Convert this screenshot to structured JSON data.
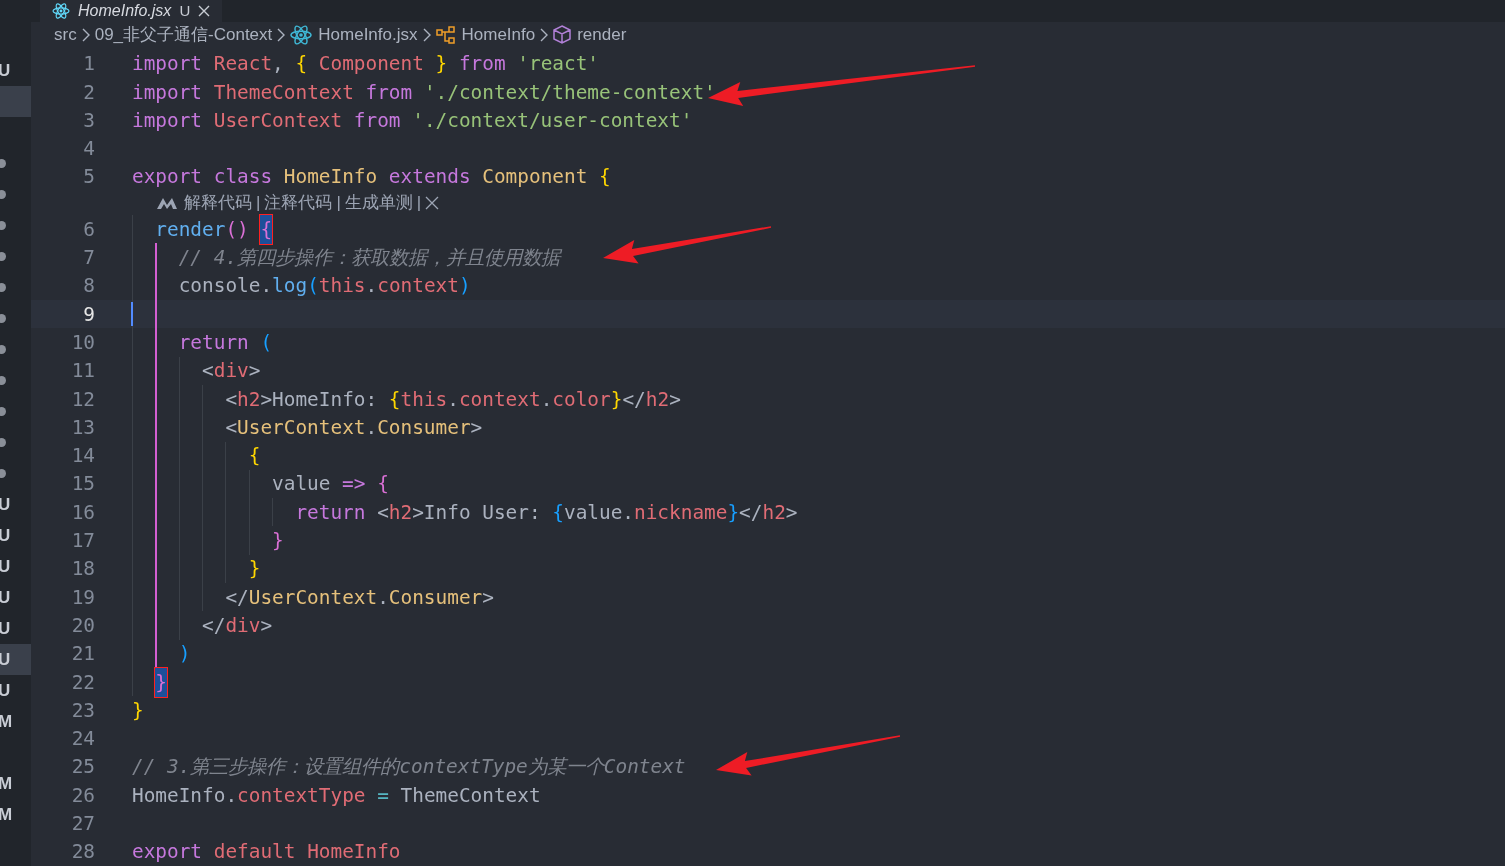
{
  "tab": {
    "title": "HomeInfo.jsx",
    "status": "U"
  },
  "breadcrumbs": [
    {
      "kind": "folder",
      "label": "src"
    },
    {
      "kind": "folder",
      "label": "09_非父子通信-Context"
    },
    {
      "kind": "react",
      "label": "HomeInfo.jsx"
    },
    {
      "kind": "component",
      "label": "HomeInfo"
    },
    {
      "kind": "method",
      "label": "render"
    }
  ],
  "explorer_markers": [
    {
      "kind": "letter",
      "text": "U",
      "selected": false
    },
    {
      "kind": "blank",
      "selected": true
    },
    {
      "kind": "blank",
      "selected": false
    },
    {
      "kind": "dot",
      "selected": false
    },
    {
      "kind": "dot",
      "selected": false
    },
    {
      "kind": "dot",
      "selected": false
    },
    {
      "kind": "dot",
      "selected": false
    },
    {
      "kind": "dot",
      "selected": false
    },
    {
      "kind": "dot",
      "selected": false
    },
    {
      "kind": "dot",
      "selected": false
    },
    {
      "kind": "dot",
      "selected": false
    },
    {
      "kind": "dot",
      "selected": false
    },
    {
      "kind": "dot",
      "selected": false
    },
    {
      "kind": "dot",
      "selected": false
    },
    {
      "kind": "letter",
      "text": "U",
      "selected": false
    },
    {
      "kind": "letter",
      "text": "U",
      "selected": false
    },
    {
      "kind": "letter",
      "text": "U",
      "selected": false
    },
    {
      "kind": "letter",
      "text": "U",
      "selected": false
    },
    {
      "kind": "letter",
      "text": "U",
      "selected": false
    },
    {
      "kind": "letter",
      "text": "U",
      "selected": true
    },
    {
      "kind": "letter",
      "text": "U",
      "selected": false
    },
    {
      "kind": "letter",
      "text": "M",
      "selected": false
    },
    {
      "kind": "blank",
      "selected": false
    },
    {
      "kind": "letter",
      "text": "M",
      "selected": false
    },
    {
      "kind": "letter",
      "text": "M",
      "selected": false
    }
  ],
  "lines": [
    {
      "kind": "code",
      "number": "1",
      "current": false,
      "tokens": [
        {
          "kind": "keyword",
          "text": "import "
        },
        {
          "kind": "variable",
          "text": "React"
        },
        {
          "kind": "plain",
          "text": ", "
        },
        {
          "kind": "bracket1",
          "text": "{ "
        },
        {
          "kind": "variable",
          "text": "Component "
        },
        {
          "kind": "bracket1",
          "text": "} "
        },
        {
          "kind": "keyword",
          "text": "from "
        },
        {
          "kind": "string",
          "text": "'react'"
        }
      ]
    },
    {
      "kind": "code",
      "number": "2",
      "current": false,
      "tokens": [
        {
          "kind": "keyword",
          "text": "import "
        },
        {
          "kind": "variable",
          "text": "ThemeContext "
        },
        {
          "kind": "keyword",
          "text": "from "
        },
        {
          "kind": "string",
          "text": "'./context/theme-context'"
        }
      ]
    },
    {
      "kind": "code",
      "number": "3",
      "current": false,
      "tokens": [
        {
          "kind": "keyword",
          "text": "import "
        },
        {
          "kind": "variable",
          "text": "UserContext "
        },
        {
          "kind": "keyword",
          "text": "from "
        },
        {
          "kind": "string",
          "text": "'./context/user-context'"
        }
      ]
    },
    {
      "kind": "code",
      "number": "4",
      "current": false
    },
    {
      "kind": "code",
      "number": "5",
      "current": false,
      "tokens": [
        {
          "kind": "keyword",
          "text": "export "
        },
        {
          "kind": "keyword",
          "text": "class "
        },
        {
          "kind": "class",
          "text": "HomeInfo "
        },
        {
          "kind": "keyword",
          "text": "extends "
        },
        {
          "kind": "class",
          "text": "Component "
        },
        {
          "kind": "bracket1",
          "text": "{"
        }
      ]
    },
    {
      "kind": "codelens",
      "actions": [
        {
          "label": "解释代码"
        },
        {
          "label": "注释代码"
        },
        {
          "label": "生成单测"
        }
      ],
      "separator": "|"
    },
    {
      "kind": "code",
      "number": "6",
      "current": false,
      "tokens": [
        {
          "kind": "function",
          "text": "  render"
        },
        {
          "kind": "bracket2",
          "text": "() "
        },
        {
          "kind": "match",
          "text": "{"
        }
      ]
    },
    {
      "kind": "code",
      "number": "7",
      "current": false,
      "scope": true,
      "tokens": [
        {
          "kind": "comment",
          "text": "    // 4.第四步操作：获取数据，并且使用数据"
        }
      ]
    },
    {
      "kind": "code",
      "number": "8",
      "current": false,
      "scope": true,
      "tokens": [
        {
          "kind": "plain",
          "text": "    console."
        },
        {
          "kind": "function",
          "text": "log"
        },
        {
          "kind": "bracket3",
          "text": "("
        },
        {
          "kind": "variable",
          "text": "this"
        },
        {
          "kind": "plain",
          "text": "."
        },
        {
          "kind": "variable",
          "text": "context"
        },
        {
          "kind": "bracket3",
          "text": ")"
        }
      ]
    },
    {
      "kind": "code",
      "number": "9",
      "current": true,
      "scope": true
    },
    {
      "kind": "code",
      "number": "10",
      "current": false,
      "scope": true,
      "tokens": [
        {
          "kind": "keyword",
          "text": "    return "
        },
        {
          "kind": "bracket3",
          "text": "("
        }
      ]
    },
    {
      "kind": "code",
      "number": "11",
      "current": false,
      "scope": true,
      "tokens": [
        {
          "kind": "plain",
          "text": "      <"
        },
        {
          "kind": "tag",
          "text": "div"
        },
        {
          "kind": "plain",
          "text": ">"
        }
      ]
    },
    {
      "kind": "code",
      "number": "12",
      "current": false,
      "scope": true,
      "tokens": [
        {
          "kind": "plain",
          "text": "        <"
        },
        {
          "kind": "tag",
          "text": "h2"
        },
        {
          "kind": "plain",
          "text": ">HomeInfo: "
        },
        {
          "kind": "bracket1",
          "text": "{"
        },
        {
          "kind": "variable",
          "text": "this"
        },
        {
          "kind": "plain",
          "text": "."
        },
        {
          "kind": "variable",
          "text": "context"
        },
        {
          "kind": "plain",
          "text": "."
        },
        {
          "kind": "variable",
          "text": "color"
        },
        {
          "kind": "bracket1",
          "text": "}"
        },
        {
          "kind": "plain",
          "text": "</"
        },
        {
          "kind": "tag",
          "text": "h2"
        },
        {
          "kind": "plain",
          "text": ">"
        }
      ]
    },
    {
      "kind": "code",
      "number": "13",
      "current": false,
      "scope": true,
      "tokens": [
        {
          "kind": "plain",
          "text": "        <"
        },
        {
          "kind": "class",
          "text": "UserContext"
        },
        {
          "kind": "plain",
          "text": "."
        },
        {
          "kind": "class",
          "text": "Consumer"
        },
        {
          "kind": "plain",
          "text": ">"
        }
      ]
    },
    {
      "kind": "code",
      "number": "14",
      "current": false,
      "scope": true,
      "tokens": [
        {
          "kind": "bracket1",
          "text": "          {"
        }
      ]
    },
    {
      "kind": "code",
      "number": "15",
      "current": false,
      "scope": true,
      "tokens": [
        {
          "kind": "plain",
          "text": "            value "
        },
        {
          "kind": "keyword",
          "text": "=> "
        },
        {
          "kind": "bracket2",
          "text": "{"
        }
      ]
    },
    {
      "kind": "code",
      "number": "16",
      "current": false,
      "scope": true,
      "tokens": [
        {
          "kind": "keyword",
          "text": "              return "
        },
        {
          "kind": "plain",
          "text": "<"
        },
        {
          "kind": "tag",
          "text": "h2"
        },
        {
          "kind": "plain",
          "text": ">Info User: "
        },
        {
          "kind": "bracket3",
          "text": "{"
        },
        {
          "kind": "plain",
          "text": "value."
        },
        {
          "kind": "variable",
          "text": "nickname"
        },
        {
          "kind": "bracket3",
          "text": "}"
        },
        {
          "kind": "plain",
          "text": "</"
        },
        {
          "kind": "tag",
          "text": "h2"
        },
        {
          "kind": "plain",
          "text": ">"
        }
      ]
    },
    {
      "kind": "code",
      "number": "17",
      "current": false,
      "scope": true,
      "tokens": [
        {
          "kind": "bracket2",
          "text": "            }"
        }
      ]
    },
    {
      "kind": "code",
      "number": "18",
      "current": false,
      "scope": true,
      "tokens": [
        {
          "kind": "bracket1",
          "text": "          }"
        }
      ]
    },
    {
      "kind": "code",
      "number": "19",
      "current": false,
      "scope": true,
      "tokens": [
        {
          "kind": "plain",
          "text": "        </"
        },
        {
          "kind": "class",
          "text": "UserContext"
        },
        {
          "kind": "plain",
          "text": "."
        },
        {
          "kind": "class",
          "text": "Consumer"
        },
        {
          "kind": "plain",
          "text": ">"
        }
      ]
    },
    {
      "kind": "code",
      "number": "20",
      "current": false,
      "scope": true,
      "tokens": [
        {
          "kind": "plain",
          "text": "      </"
        },
        {
          "kind": "tag",
          "text": "div"
        },
        {
          "kind": "plain",
          "text": ">"
        }
      ]
    },
    {
      "kind": "code",
      "number": "21",
      "current": false,
      "scope": true,
      "tokens": [
        {
          "kind": "bracket3",
          "text": "    )"
        }
      ]
    },
    {
      "kind": "code",
      "number": "22",
      "current": false,
      "tokens": [
        {
          "kind": "match",
          "text": "  }"
        }
      ]
    },
    {
      "kind": "code",
      "number": "23",
      "current": false,
      "tokens": [
        {
          "kind": "bracket1",
          "text": "}"
        }
      ]
    },
    {
      "kind": "code",
      "number": "24",
      "current": false
    },
    {
      "kind": "code",
      "number": "25",
      "current": false,
      "tokens": [
        {
          "kind": "comment",
          "text": "// 3.第三步操作：设置组件的contextType为某一个Context"
        }
      ]
    },
    {
      "kind": "code",
      "number": "26",
      "current": false,
      "tokens": [
        {
          "kind": "plain",
          "text": "HomeInfo."
        },
        {
          "kind": "variable",
          "text": "contextType "
        },
        {
          "kind": "operator",
          "text": "= "
        },
        {
          "kind": "plain",
          "text": "ThemeContext"
        }
      ]
    },
    {
      "kind": "code",
      "number": "27",
      "current": false
    },
    {
      "kind": "code",
      "number": "28",
      "current": false,
      "tokens": [
        {
          "kind": "keyword",
          "text": "export "
        },
        {
          "kind": "variable",
          "text": "default "
        },
        {
          "kind": "variable",
          "text": "HomeInfo"
        }
      ]
    }
  ]
}
